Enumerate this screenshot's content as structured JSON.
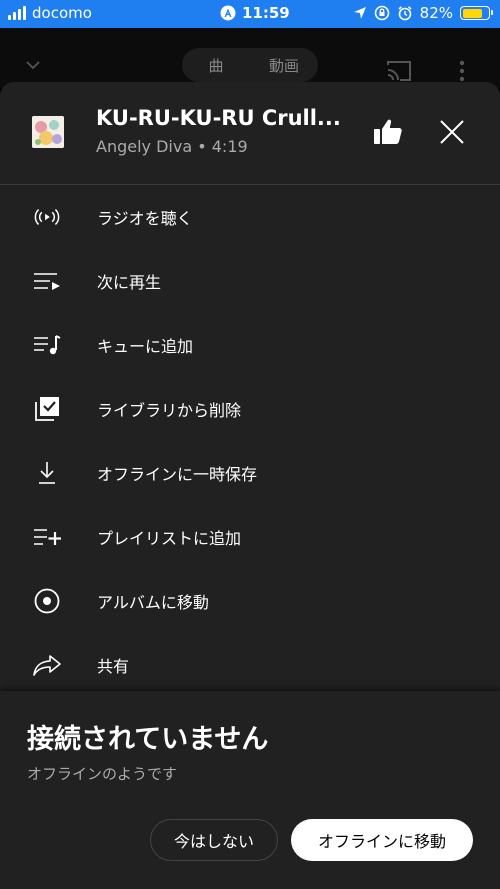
{
  "status_bar": {
    "carrier": "docomo",
    "time": "11:59",
    "battery": "82%",
    "battery_level": 0.82,
    "battery_color": "#ffd60a",
    "bar_color": "#1f7ff0"
  },
  "player_header": {
    "tabs": [
      "曲",
      "動画"
    ],
    "icons": [
      "chevron-down-icon",
      "cast-icon",
      "more-vert-icon"
    ]
  },
  "song": {
    "title": "KU-RU-KU-RU Crull...",
    "artist": "Angely Diva",
    "separator": "•",
    "duration": "4:19"
  },
  "menu": {
    "items": [
      {
        "label": "ラジオを聴く",
        "icon": "radio-icon"
      },
      {
        "label": "次に再生",
        "icon": "play-next-icon"
      },
      {
        "label": "キューに追加",
        "icon": "add-to-queue-icon"
      },
      {
        "label": "ライブラリから削除",
        "icon": "library-remove-icon"
      },
      {
        "label": "オフラインに一時保存",
        "icon": "download-icon"
      },
      {
        "label": "プレイリストに追加",
        "icon": "playlist-add-icon"
      },
      {
        "label": "アルバムに移動",
        "icon": "album-icon"
      },
      {
        "label": "共有",
        "icon": "share-icon"
      }
    ]
  },
  "offline": {
    "title": "接続されていません",
    "subtitle": "オフラインのようです",
    "not_now": "今はしない",
    "go_offline": "オフラインに移動"
  }
}
